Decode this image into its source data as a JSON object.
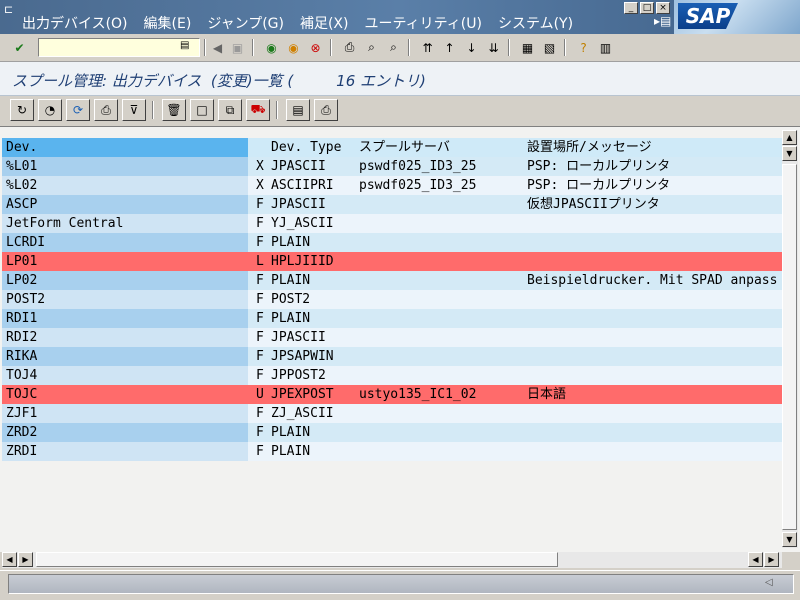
{
  "menu": {
    "items": [
      "出力デバイス(O)",
      "編集(E)",
      "ジャンプ(G)",
      "補足(X)",
      "ユーティリティ(U)",
      "システム(Y)"
    ]
  },
  "toolbar": {
    "command_value": ""
  },
  "title": "スプール管理: 出力デバイス  (変更)一覧 (         16 エントリ)",
  "list": {
    "headers": {
      "dev": "Dev.",
      "type": "Dev. Type",
      "server": "スプールサーバ",
      "location": "設置場所/メッセージ"
    },
    "rows": [
      {
        "dev": "%L01",
        "flag": "X",
        "type": "JPASCII",
        "server": "pswdf025_ID3_25",
        "location": "PSP: ローカルプリンタ",
        "style": "odd"
      },
      {
        "dev": "%L02",
        "flag": "X",
        "type": "ASCIIPRI",
        "server": "pswdf025_ID3_25",
        "location": "PSP: ローカルプリンタ",
        "style": "even"
      },
      {
        "dev": "ASCP",
        "flag": "F",
        "type": "JPASCII",
        "server": "",
        "location": "仮想JPASCIIプリンタ",
        "style": "odd"
      },
      {
        "dev": "JetForm Central",
        "flag": "F",
        "type": "YJ_ASCII",
        "server": "",
        "location": "",
        "style": "even"
      },
      {
        "dev": "LCRDI",
        "flag": "F",
        "type": "PLAIN",
        "server": "",
        "location": "",
        "style": "odd"
      },
      {
        "dev": "LP01",
        "flag": "L",
        "type": "HPLJIIID",
        "server": "",
        "location": "",
        "style": "err"
      },
      {
        "dev": "LP02",
        "flag": "F",
        "type": "PLAIN",
        "server": "",
        "location": "Beispieldrucker. Mit SPAD anpass",
        "style": "odd"
      },
      {
        "dev": "POST2",
        "flag": "F",
        "type": "POST2",
        "server": "",
        "location": "",
        "style": "even"
      },
      {
        "dev": "RDI1",
        "flag": "F",
        "type": "PLAIN",
        "server": "",
        "location": "",
        "style": "odd"
      },
      {
        "dev": "RDI2",
        "flag": "F",
        "type": "JPASCII",
        "server": "",
        "location": "",
        "style": "even"
      },
      {
        "dev": "RIKA",
        "flag": "F",
        "type": "JPSAPWIN",
        "server": "",
        "location": "",
        "style": "odd"
      },
      {
        "dev": "TOJ4",
        "flag": "F",
        "type": "JPPOST2",
        "server": "",
        "location": "",
        "style": "even"
      },
      {
        "dev": "TOJC",
        "flag": "U",
        "type": "JPEXPOST",
        "server": "ustyo135_IC1_02",
        "location": "日本語",
        "style": "err"
      },
      {
        "dev": "ZJF1",
        "flag": "F",
        "type": "ZJ_ASCII",
        "server": "",
        "location": "",
        "style": "even"
      },
      {
        "dev": "ZRD2",
        "flag": "F",
        "type": "PLAIN",
        "server": "",
        "location": "",
        "style": "odd"
      },
      {
        "dev": "ZRDI",
        "flag": "F",
        "type": "PLAIN",
        "server": "",
        "location": "",
        "style": "even"
      }
    ]
  },
  "logo": "SAP",
  "colors": {
    "header_dev": "#5ab4ee",
    "error_row": "#ff6b6b",
    "title_text": "#1f3f74"
  }
}
